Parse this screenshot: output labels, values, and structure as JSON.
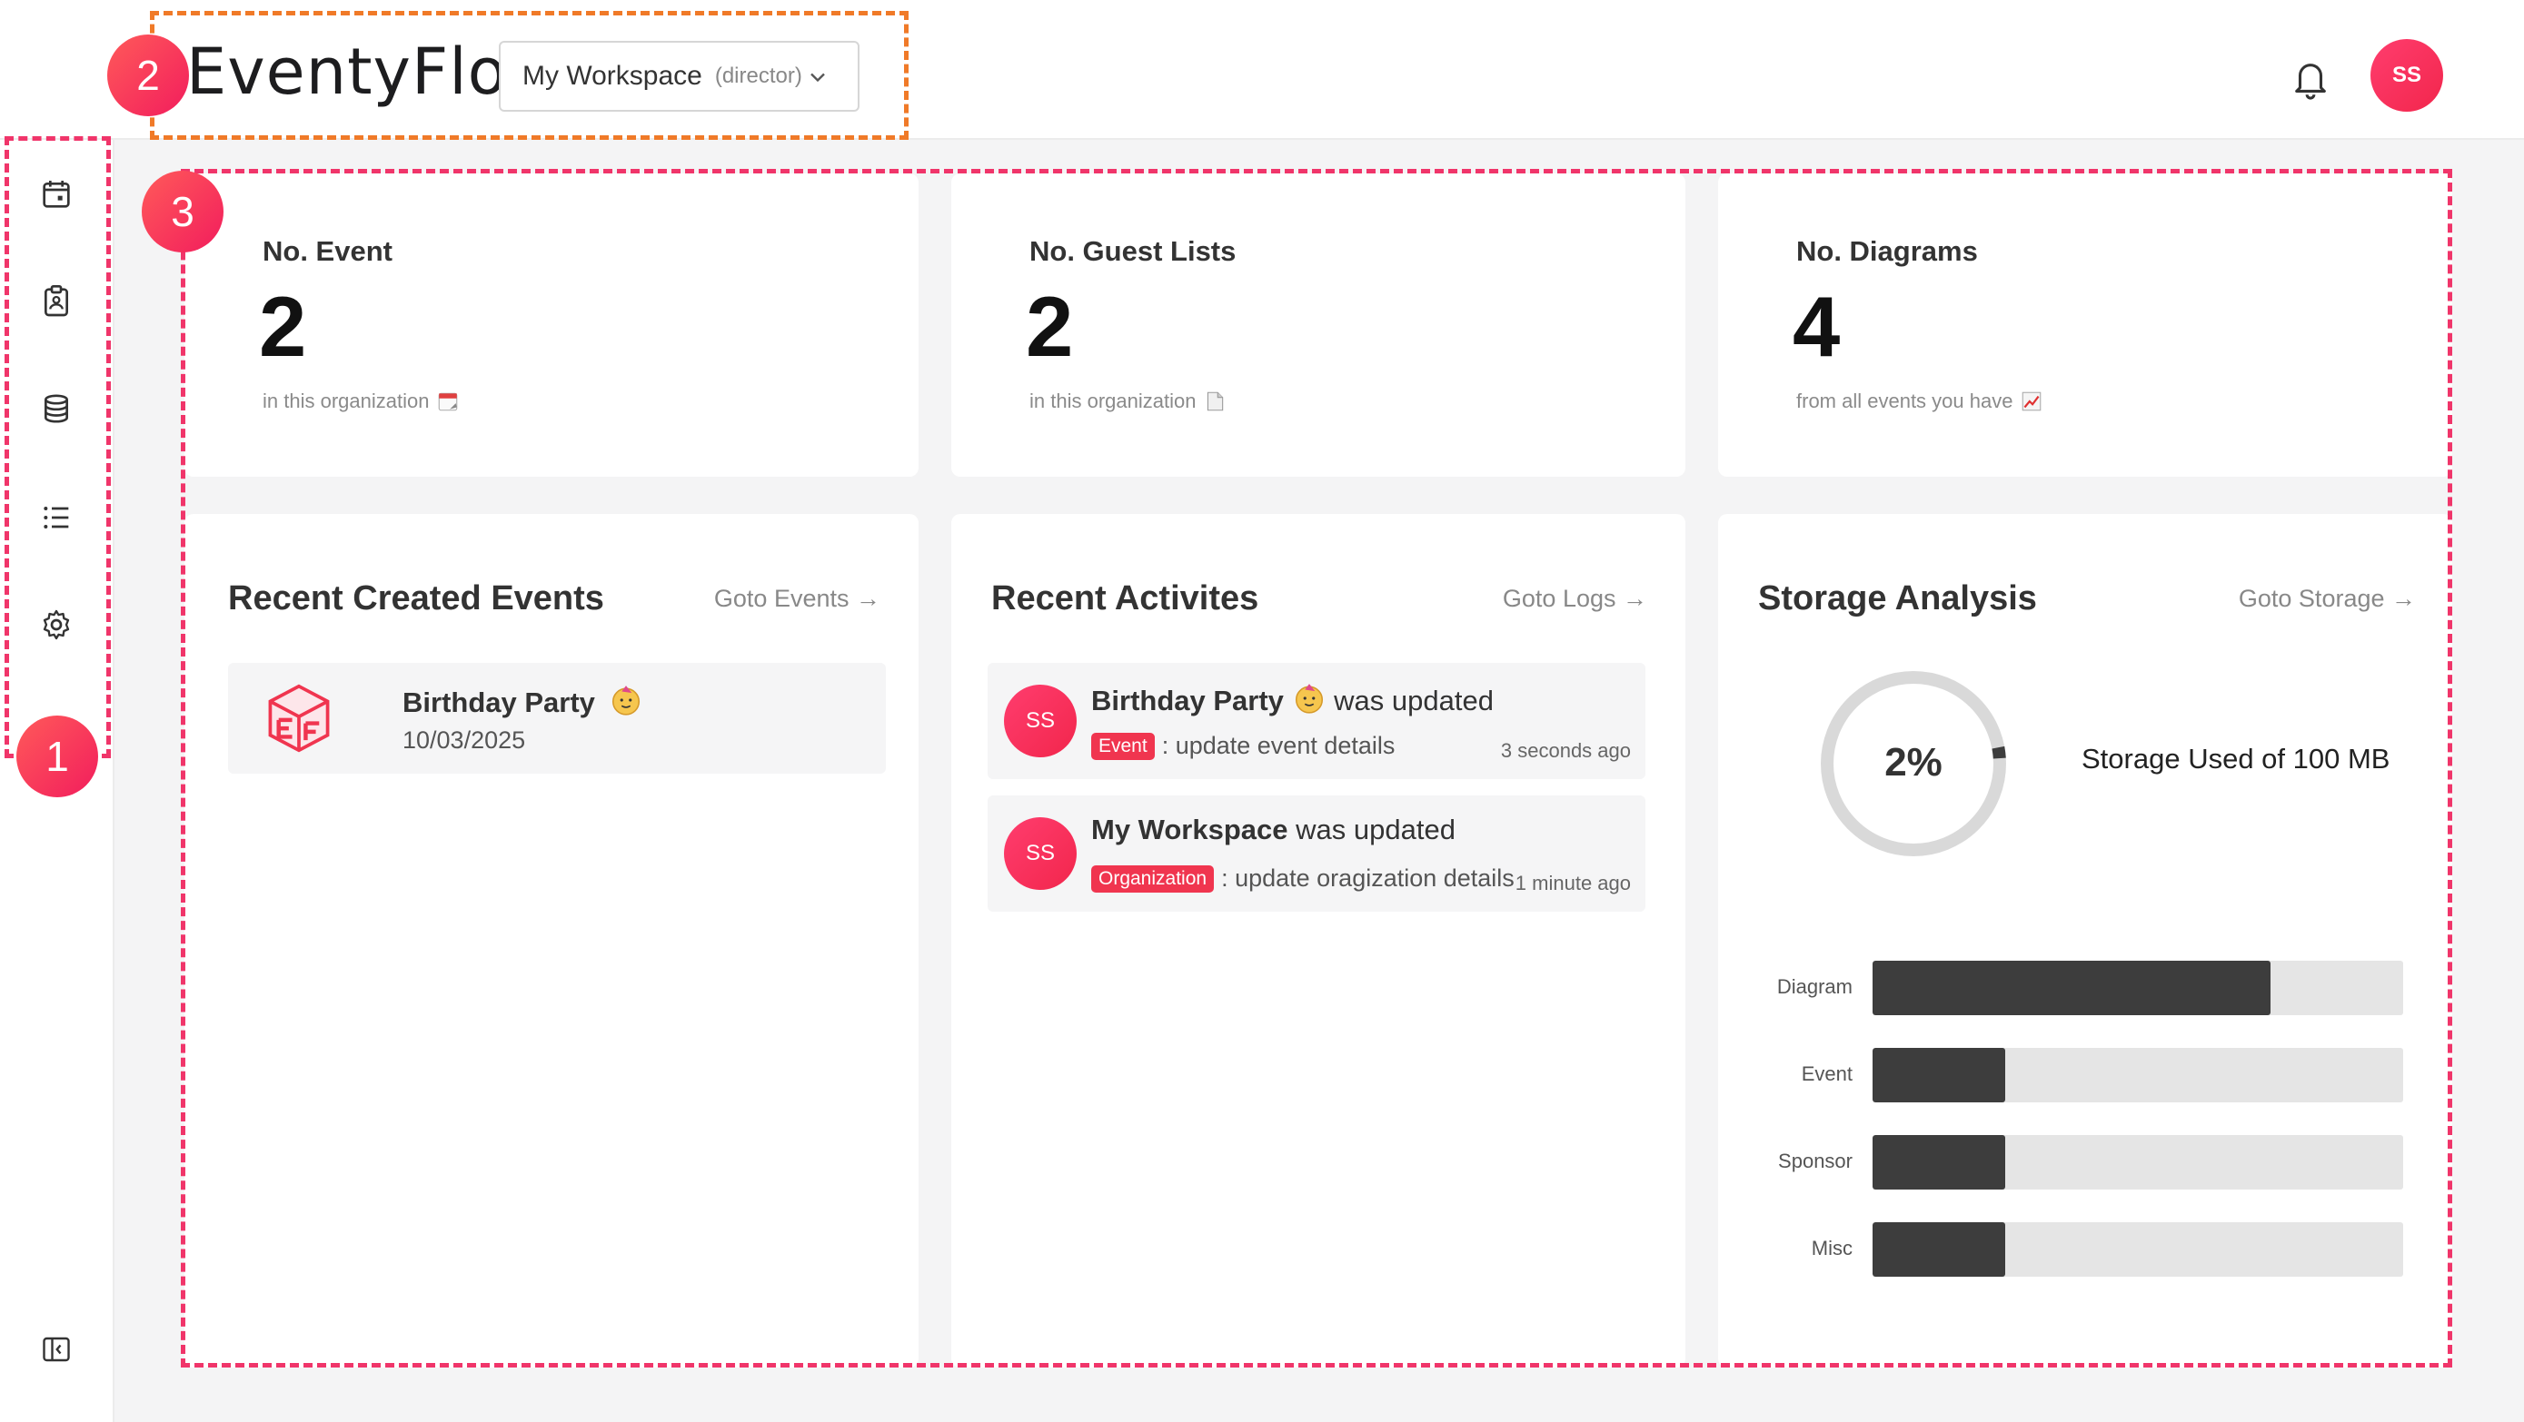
{
  "header": {
    "logo_text": "EventyFlo",
    "workspace": {
      "name": "My Workspace",
      "role": "(director)"
    },
    "avatar_initials": "SS"
  },
  "annotations": [
    "1",
    "2",
    "3"
  ],
  "sidebar": {
    "items": [
      {
        "icon": "calendar-icon"
      },
      {
        "icon": "clipboard-icon"
      },
      {
        "icon": "database-icon"
      },
      {
        "icon": "list-icon"
      },
      {
        "icon": "gear-icon"
      }
    ],
    "collapse_icon": "sidebar-collapse-icon"
  },
  "stats": [
    {
      "label": "No. Event",
      "value": "2",
      "sub": "in this organization",
      "emoji": "calendar"
    },
    {
      "label": "No. Guest Lists",
      "value": "2",
      "sub": "in this organization",
      "emoji": "page"
    },
    {
      "label": "No. Diagrams",
      "value": "4",
      "sub": "from all events you have",
      "emoji": "chart"
    }
  ],
  "recent_events": {
    "title": "Recent Created Events",
    "link": "Goto Events →",
    "items": [
      {
        "name": "Birthday Party",
        "date": "10/03/2025"
      }
    ]
  },
  "recent_activities": {
    "title": "Recent Activites",
    "link": "Goto Logs →",
    "items": [
      {
        "avatar": "SS",
        "subject": "Birthday Party",
        "verb": "was updated",
        "tag": "Event",
        "desc": ": update event details",
        "time": "3 seconds ago"
      },
      {
        "avatar": "SS",
        "subject": "My Workspace",
        "verb": "was updated",
        "tag": "Organization",
        "desc": ": update oragization details",
        "time": "1 minute ago"
      }
    ]
  },
  "storage": {
    "title": "Storage Analysis",
    "link": "Goto Storage →",
    "percent_label": "2%",
    "percent": 2,
    "used_text": "Storage Used of 100 MB",
    "colors": {
      "ring": "#d9d9d9",
      "ring_fill": "#3d3d3d",
      "bar_fill": "#3d3d3d"
    },
    "bars": [
      {
        "label": "Diagram",
        "fraction": 0.75
      },
      {
        "label": "Event",
        "fraction": 0.25
      },
      {
        "label": "Sponsor",
        "fraction": 0.25
      },
      {
        "label": "Misc",
        "fraction": 0.25
      }
    ]
  }
}
